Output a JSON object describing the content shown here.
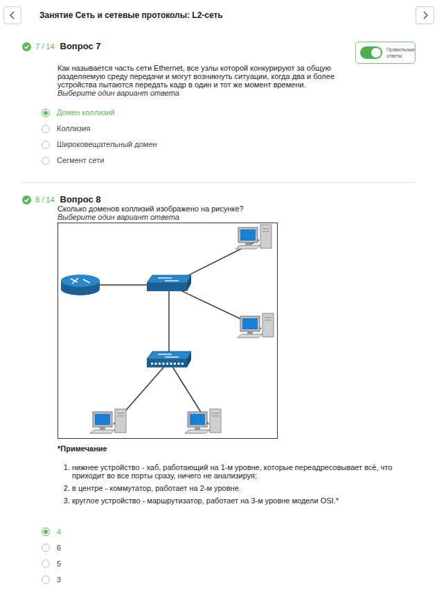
{
  "header": {
    "title": "Занятие Сеть и сетевые протоколы: L2-сеть"
  },
  "questions": [
    {
      "progress": "7 / 14",
      "title": "Вопрос 7",
      "answered": true,
      "toggle": {
        "label": "Правильные ответы",
        "on": true
      },
      "text": "Как называется часть сети Ethernet, все узлы которой конкурируют за общую разделяемую среду передачи и могут возникнуть ситуации, когда два и более устройства пытаются передать кадр в один и тот же момент времени.",
      "hint": "Выберите один вариант ответа",
      "options": [
        {
          "label": "Домен коллизий",
          "selected": true
        },
        {
          "label": "Коллизия",
          "selected": false
        },
        {
          "label": "Широковещательный домен",
          "selected": false
        },
        {
          "label": "Сегмент сети",
          "selected": false
        }
      ]
    },
    {
      "progress": "8 / 14",
      "title": "Вопрос 8",
      "answered": true,
      "text": "Сколько доменов коллизий изображено на рисунке?",
      "hint": "Выберите один вариант ответа",
      "figure": {
        "nodes": [
          {
            "kind": "router"
          },
          {
            "kind": "switch"
          },
          {
            "kind": "pc"
          },
          {
            "kind": "pc"
          },
          {
            "kind": "hub"
          },
          {
            "kind": "pc"
          },
          {
            "kind": "pc"
          }
        ],
        "links": [
          [
            0,
            1
          ],
          [
            1,
            2
          ],
          [
            1,
            3
          ],
          [
            1,
            4
          ],
          [
            4,
            5
          ],
          [
            4,
            6
          ]
        ]
      },
      "note": {
        "title": "*Примечание",
        "items": [
          "нижнее устройство - хаб, работающий на 1-м уровне, которые переадресовывает всё, что приходит во все порты сразу, ничего не анализируя;",
          "в центре - коммутатор, работает на 2-м уровне.",
          "круглое устройство - маршрутизатор, работает на 3-м уровне модели OSI.*"
        ]
      },
      "options": [
        {
          "label": "4",
          "selected": true
        },
        {
          "label": "6",
          "selected": false
        },
        {
          "label": "5",
          "selected": false
        },
        {
          "label": "3",
          "selected": false
        }
      ]
    }
  ]
}
